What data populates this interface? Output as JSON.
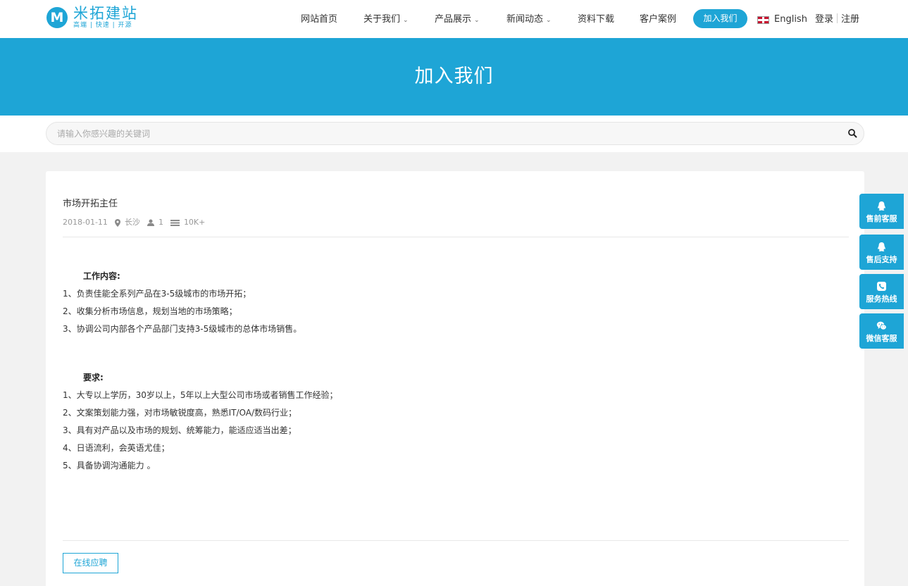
{
  "brand": {
    "logo_letter": "M",
    "name": "米拓建站",
    "slogan": "高端 | 快速 | 开源",
    "accent": "#1ea5d6"
  },
  "nav": {
    "items": [
      {
        "label": "网站首页",
        "dropdown": false
      },
      {
        "label": "关于我们",
        "dropdown": true
      },
      {
        "label": "产品展示",
        "dropdown": true
      },
      {
        "label": "新闻动态",
        "dropdown": true
      },
      {
        "label": "资料下载",
        "dropdown": false
      },
      {
        "label": "客户案例",
        "dropdown": false
      }
    ],
    "active": "加入我们",
    "language": "English",
    "login": "登录",
    "register": "注册"
  },
  "banner": {
    "title": "加入我们"
  },
  "search": {
    "placeholder": "请输入你感兴趣的关键词",
    "value": ""
  },
  "job": {
    "title": "市场开拓主任",
    "date": "2018-01-11",
    "location": "长沙",
    "headcount": "1",
    "salary": "10K+",
    "duties_title": "工作内容:",
    "duties": [
      "1、负责佳能全系列产品在3-5级城市的市场开拓；",
      "2、收集分析市场信息，规划当地的市场策略；",
      "3、协调公司内部各个产品部门支持3-5级城市的总体市场销售。"
    ],
    "requirements_title": "要求:",
    "requirements": [
      "1、大专以上学历，30岁以上，5年以上大型公司市场或者销售工作经验；",
      "2、文案策划能力强，对市场敏锐度高，熟悉IT/OA/数码行业；",
      "3、具有对产品以及市场的规划、统筹能力，能适应适当出差；",
      "4、日语流利，会英语尤佳；",
      "5、具备协调沟通能力 。"
    ],
    "apply_label": "在线应聘"
  },
  "side_service": [
    {
      "label": "售前客服",
      "icon": "qq-icon"
    },
    {
      "label": "售后支持",
      "icon": "qq-icon"
    },
    {
      "label": "服务热线",
      "icon": "phone-icon"
    },
    {
      "label": "微信客服",
      "icon": "wechat-icon"
    }
  ]
}
